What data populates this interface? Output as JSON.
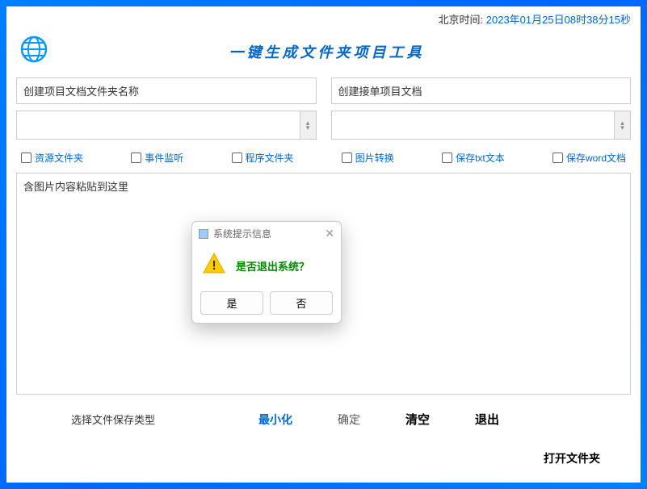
{
  "time": {
    "label": "北京时间: ",
    "value": "2023年01月25日08时38分15秒"
  },
  "title": "一键生成文件夹项目工具",
  "inputs": {
    "left_label": "创建项目文档文件夹名称",
    "right_label": "创建接单项目文档"
  },
  "checkboxes": [
    "资源文件夹",
    "事件监听",
    "程序文件夹",
    "图片转换",
    "保存txt文本",
    "保存word文档"
  ],
  "textarea_placeholder": "含图片内容粘贴到这里",
  "bottom": {
    "label": "选择文件保存类型",
    "minimize": "最小化",
    "ok": "确定",
    "clear": "清空",
    "exit": "退出",
    "open_folder": "打开文件夹"
  },
  "modal": {
    "title": "系统提示信息",
    "message": "是否退出系统？",
    "yes": "是",
    "no": "否"
  }
}
